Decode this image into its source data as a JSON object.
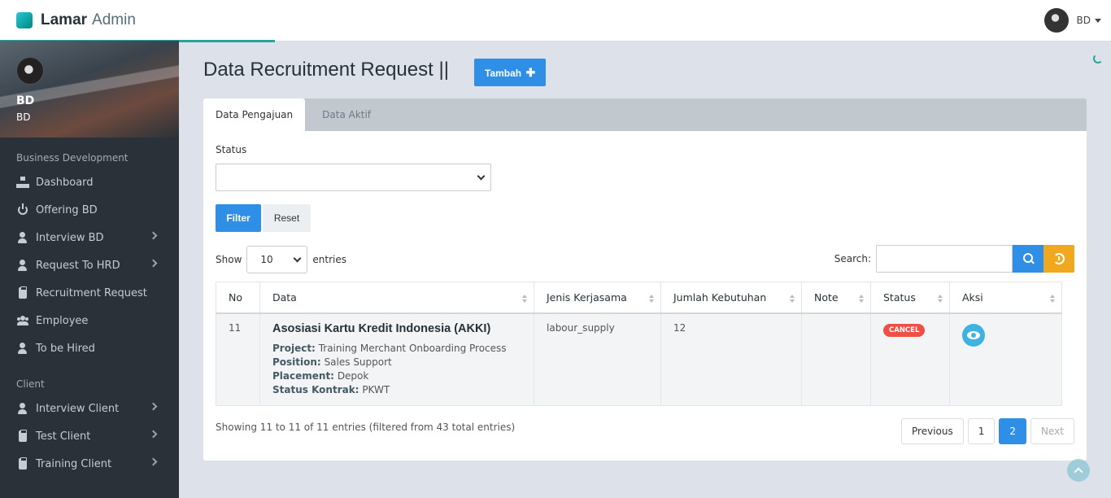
{
  "brand": {
    "name": "Lamar",
    "sub": "Admin"
  },
  "topbar": {
    "user": "BD"
  },
  "sidebar": {
    "profile": {
      "name": "BD",
      "role": "BD"
    },
    "sections": [
      {
        "title": "Business Development",
        "items": [
          {
            "label": "Dashboard",
            "icon": "sitemap-icon"
          },
          {
            "label": "Offering BD",
            "icon": "power-icon"
          },
          {
            "label": "Interview BD",
            "icon": "user-icon",
            "submenu": true
          },
          {
            "label": "Request To HRD",
            "icon": "user-icon",
            "submenu": true
          },
          {
            "label": "Recruitment Request",
            "icon": "clipboard-icon"
          },
          {
            "label": "Employee",
            "icon": "users-icon"
          },
          {
            "label": "To be Hired",
            "icon": "user-icon"
          }
        ]
      },
      {
        "title": "Client",
        "items": [
          {
            "label": "Interview Client",
            "icon": "user-icon",
            "submenu": true
          },
          {
            "label": "Test Client",
            "icon": "clipboard-icon",
            "submenu": true
          },
          {
            "label": "Training Client",
            "icon": "clipboard-icon",
            "submenu": true
          }
        ]
      }
    ]
  },
  "page": {
    "title": "Data Recruitment Request ||",
    "add_button": "Tambah"
  },
  "tabs": [
    "Data Pengajuan",
    "Data Aktif"
  ],
  "filter": {
    "status_label": "Status",
    "status_value": "",
    "filter_button": "Filter",
    "reset_button": "Reset"
  },
  "table_controls": {
    "show_label": "Show",
    "page_length": "10",
    "entries_label": "entries",
    "search_label": "Search:",
    "search_value": ""
  },
  "table": {
    "columns": [
      "No",
      "Data",
      "Jenis Kerjasama",
      "Jumlah Kebutuhan",
      "Note",
      "Status",
      "Aksi"
    ],
    "rows": [
      {
        "no": "11",
        "client": "Asosiasi Kartu Kredit Indonesia (AKKI)",
        "project_label": "Project:",
        "project": "Training Merchant Onboarding Process",
        "position_label": "Position:",
        "position": "Sales Support",
        "placement_label": "Placement:",
        "placement": "Depok",
        "contract_label": "Status Kontrak:",
        "contract": "PKWT",
        "jenis": "labour_supply",
        "jumlah": "12",
        "note": "",
        "status": "CANCEL"
      }
    ]
  },
  "footer": {
    "info": "Showing 11 to 11 of 11 entries (filtered from 43 total entries)",
    "pagination": {
      "previous": "Previous",
      "pages": [
        "1",
        "2"
      ],
      "active_page": "2",
      "next": "Next"
    }
  },
  "colors": {
    "primary": "#2f8ee5",
    "accent": "#26a69a",
    "warning": "#f0a81e",
    "danger": "#ef4f45",
    "sidebar": "#2b3138"
  }
}
